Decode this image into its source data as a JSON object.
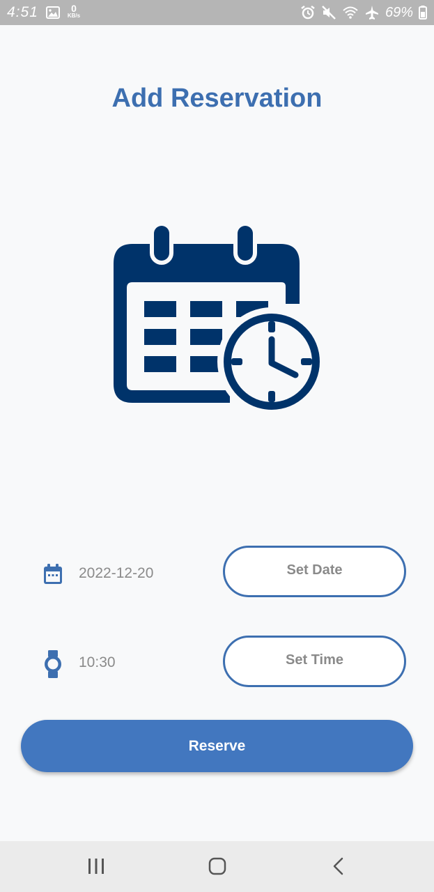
{
  "status_bar": {
    "time": "4:51",
    "net_speed_value": "0",
    "net_speed_unit": "KB/s",
    "battery": "69%",
    "icons": [
      "gallery-icon",
      "alarm-icon",
      "mute-icon",
      "wifi-icon",
      "airplane-icon",
      "battery-icon"
    ]
  },
  "page": {
    "title": "Add Reservation",
    "hero_icon": "calendar-clock-icon"
  },
  "date_row": {
    "icon": "calendar-icon",
    "value": "2022-12-20",
    "button_label": "Set Date"
  },
  "time_row": {
    "icon": "watch-icon",
    "value": "10:30",
    "button_label": "Set Time"
  },
  "reserve_button": {
    "label": "Reserve"
  },
  "nav_bar": {
    "icons": [
      "recent-apps-icon",
      "home-icon",
      "back-icon"
    ]
  },
  "colors": {
    "accent": "#4277bf",
    "title": "#3d6fb0",
    "hero": "#00336a",
    "text_muted": "#8a8a8a",
    "background": "#f8f9fa",
    "status_bar": "#b5b5b5",
    "nav_bar": "#ebebeb"
  }
}
